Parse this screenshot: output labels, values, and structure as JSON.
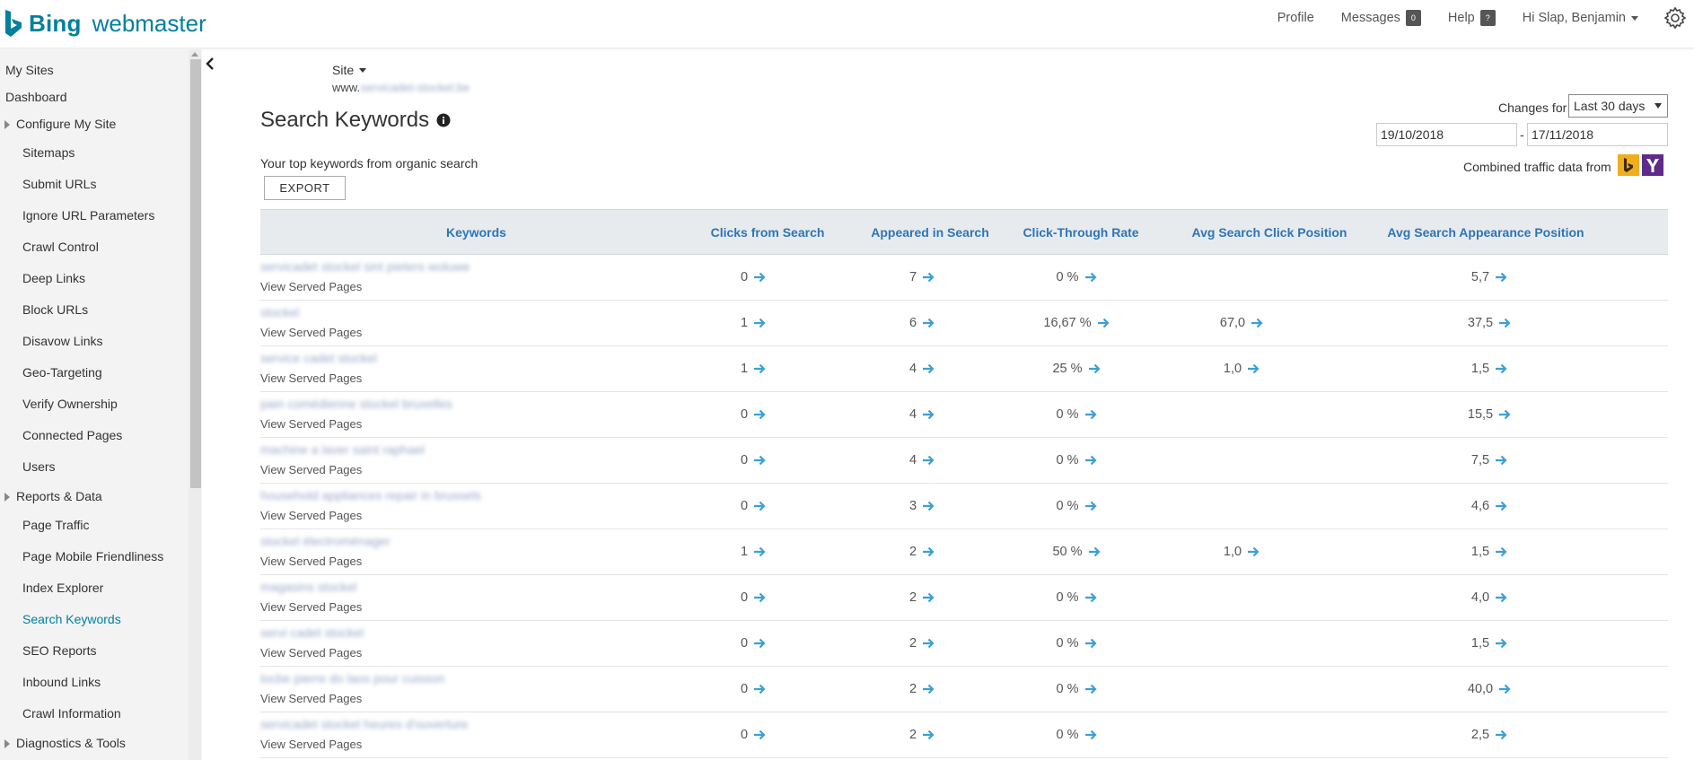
{
  "header": {
    "logo_bing": "Bing",
    "logo_webmaster": "webmaster",
    "nav": {
      "profile": "Profile",
      "messages": "Messages",
      "messages_count": "0",
      "help": "Help",
      "help_badge": "?",
      "user_greeting": "Hi Slap, Benjamin"
    },
    "icons": [
      "bing-logo-icon",
      "caret-down-icon",
      "gear-icon"
    ]
  },
  "sidebar": {
    "items": [
      {
        "label": "My Sites",
        "level": "top"
      },
      {
        "label": "Dashboard",
        "level": "top"
      },
      {
        "label": "Configure My Site",
        "level": "group"
      },
      {
        "label": "Sitemaps",
        "level": "sub"
      },
      {
        "label": "Submit URLs",
        "level": "sub"
      },
      {
        "label": "Ignore URL Parameters",
        "level": "sub"
      },
      {
        "label": "Crawl Control",
        "level": "sub"
      },
      {
        "label": "Deep Links",
        "level": "sub"
      },
      {
        "label": "Block URLs",
        "level": "sub"
      },
      {
        "label": "Disavow Links",
        "level": "sub"
      },
      {
        "label": "Geo-Targeting",
        "level": "sub"
      },
      {
        "label": "Verify Ownership",
        "level": "sub"
      },
      {
        "label": "Connected Pages",
        "level": "sub"
      },
      {
        "label": "Users",
        "level": "sub"
      },
      {
        "label": "Reports & Data",
        "level": "group"
      },
      {
        "label": "Page Traffic",
        "level": "sub"
      },
      {
        "label": "Page Mobile Friendliness",
        "level": "sub"
      },
      {
        "label": "Index Explorer",
        "level": "sub"
      },
      {
        "label": "Search Keywords",
        "level": "sub",
        "active": true
      },
      {
        "label": "SEO Reports",
        "level": "sub"
      },
      {
        "label": "Inbound Links",
        "level": "sub"
      },
      {
        "label": "Crawl Information",
        "level": "sub"
      },
      {
        "label": "Diagnostics & Tools",
        "level": "group"
      }
    ],
    "active_color": "#00809d"
  },
  "site": {
    "label": "Site",
    "url_prefix": "www.",
    "url_obscured": "servicadet-stockel.be"
  },
  "page": {
    "title": "Search Keywords",
    "subtitle": "Your top keywords from organic search",
    "export_label": "EXPORT",
    "changes_for_label": "Changes for",
    "range_selected": "Last 30 days",
    "date_from": "19/10/2018",
    "date_separator": "-",
    "date_to": "17/11/2018",
    "combined_label": "Combined traffic data from",
    "sources": [
      "bing-icon",
      "yahoo-icon"
    ]
  },
  "table": {
    "columns": [
      "Keywords",
      "Clicks from Search",
      "Appeared in Search",
      "Click-Through Rate",
      "Avg Search Click Position",
      "Avg Search Appearance Position"
    ],
    "rows": [
      {
        "keyword": "servicadet stockel sint pieters woluwe",
        "link": "View Served Pages",
        "clicks": "0",
        "appeared": "7",
        "ctr": "0 %",
        "avg_click": "",
        "avg_appear": "5,7"
      },
      {
        "keyword": "stockel",
        "link": "View Served Pages",
        "clicks": "1",
        "appeared": "6",
        "ctr": "16,67 %",
        "avg_click": "67,0",
        "avg_appear": "37,5"
      },
      {
        "keyword": "service cadet stockel",
        "link": "View Served Pages",
        "clicks": "1",
        "appeared": "4",
        "ctr": "25 %",
        "avg_click": "1,0",
        "avg_appear": "1,5"
      },
      {
        "keyword": "pain comédienne stockel bruxelles",
        "link": "View Served Pages",
        "clicks": "0",
        "appeared": "4",
        "ctr": "0 %",
        "avg_click": "",
        "avg_appear": "15,5"
      },
      {
        "keyword": "machine a laver saint raphael",
        "link": "View Served Pages",
        "clicks": "0",
        "appeared": "4",
        "ctr": "0 %",
        "avg_click": "",
        "avg_appear": "7,5"
      },
      {
        "keyword": "household appliances repair in brussels",
        "link": "View Served Pages",
        "clicks": "0",
        "appeared": "3",
        "ctr": "0 %",
        "avg_click": "",
        "avg_appear": "4,6"
      },
      {
        "keyword": "stockel électroménager",
        "link": "View Served Pages",
        "clicks": "1",
        "appeared": "2",
        "ctr": "50 %",
        "avg_click": "1,0",
        "avg_appear": "1,5"
      },
      {
        "keyword": "magasins stockel",
        "link": "View Served Pages",
        "clicks": "0",
        "appeared": "2",
        "ctr": "0 %",
        "avg_click": "",
        "avg_appear": "4,0"
      },
      {
        "keyword": "servi cadet stockel",
        "link": "View Served Pages",
        "clicks": "0",
        "appeared": "2",
        "ctr": "0 %",
        "avg_click": "",
        "avg_appear": "1,5"
      },
      {
        "keyword": "locbe pierre do laos pour cuisson",
        "link": "View Served Pages",
        "clicks": "0",
        "appeared": "2",
        "ctr": "0 %",
        "avg_click": "",
        "avg_appear": "40,0"
      },
      {
        "keyword": "servicadet stockel heures d'ouverture",
        "link": "View Served Pages",
        "clicks": "0",
        "appeared": "2",
        "ctr": "0 %",
        "avg_click": "",
        "avg_appear": "2,5"
      }
    ],
    "header_color": "#2e75b6",
    "arrow_color": "#3aa0d8"
  }
}
